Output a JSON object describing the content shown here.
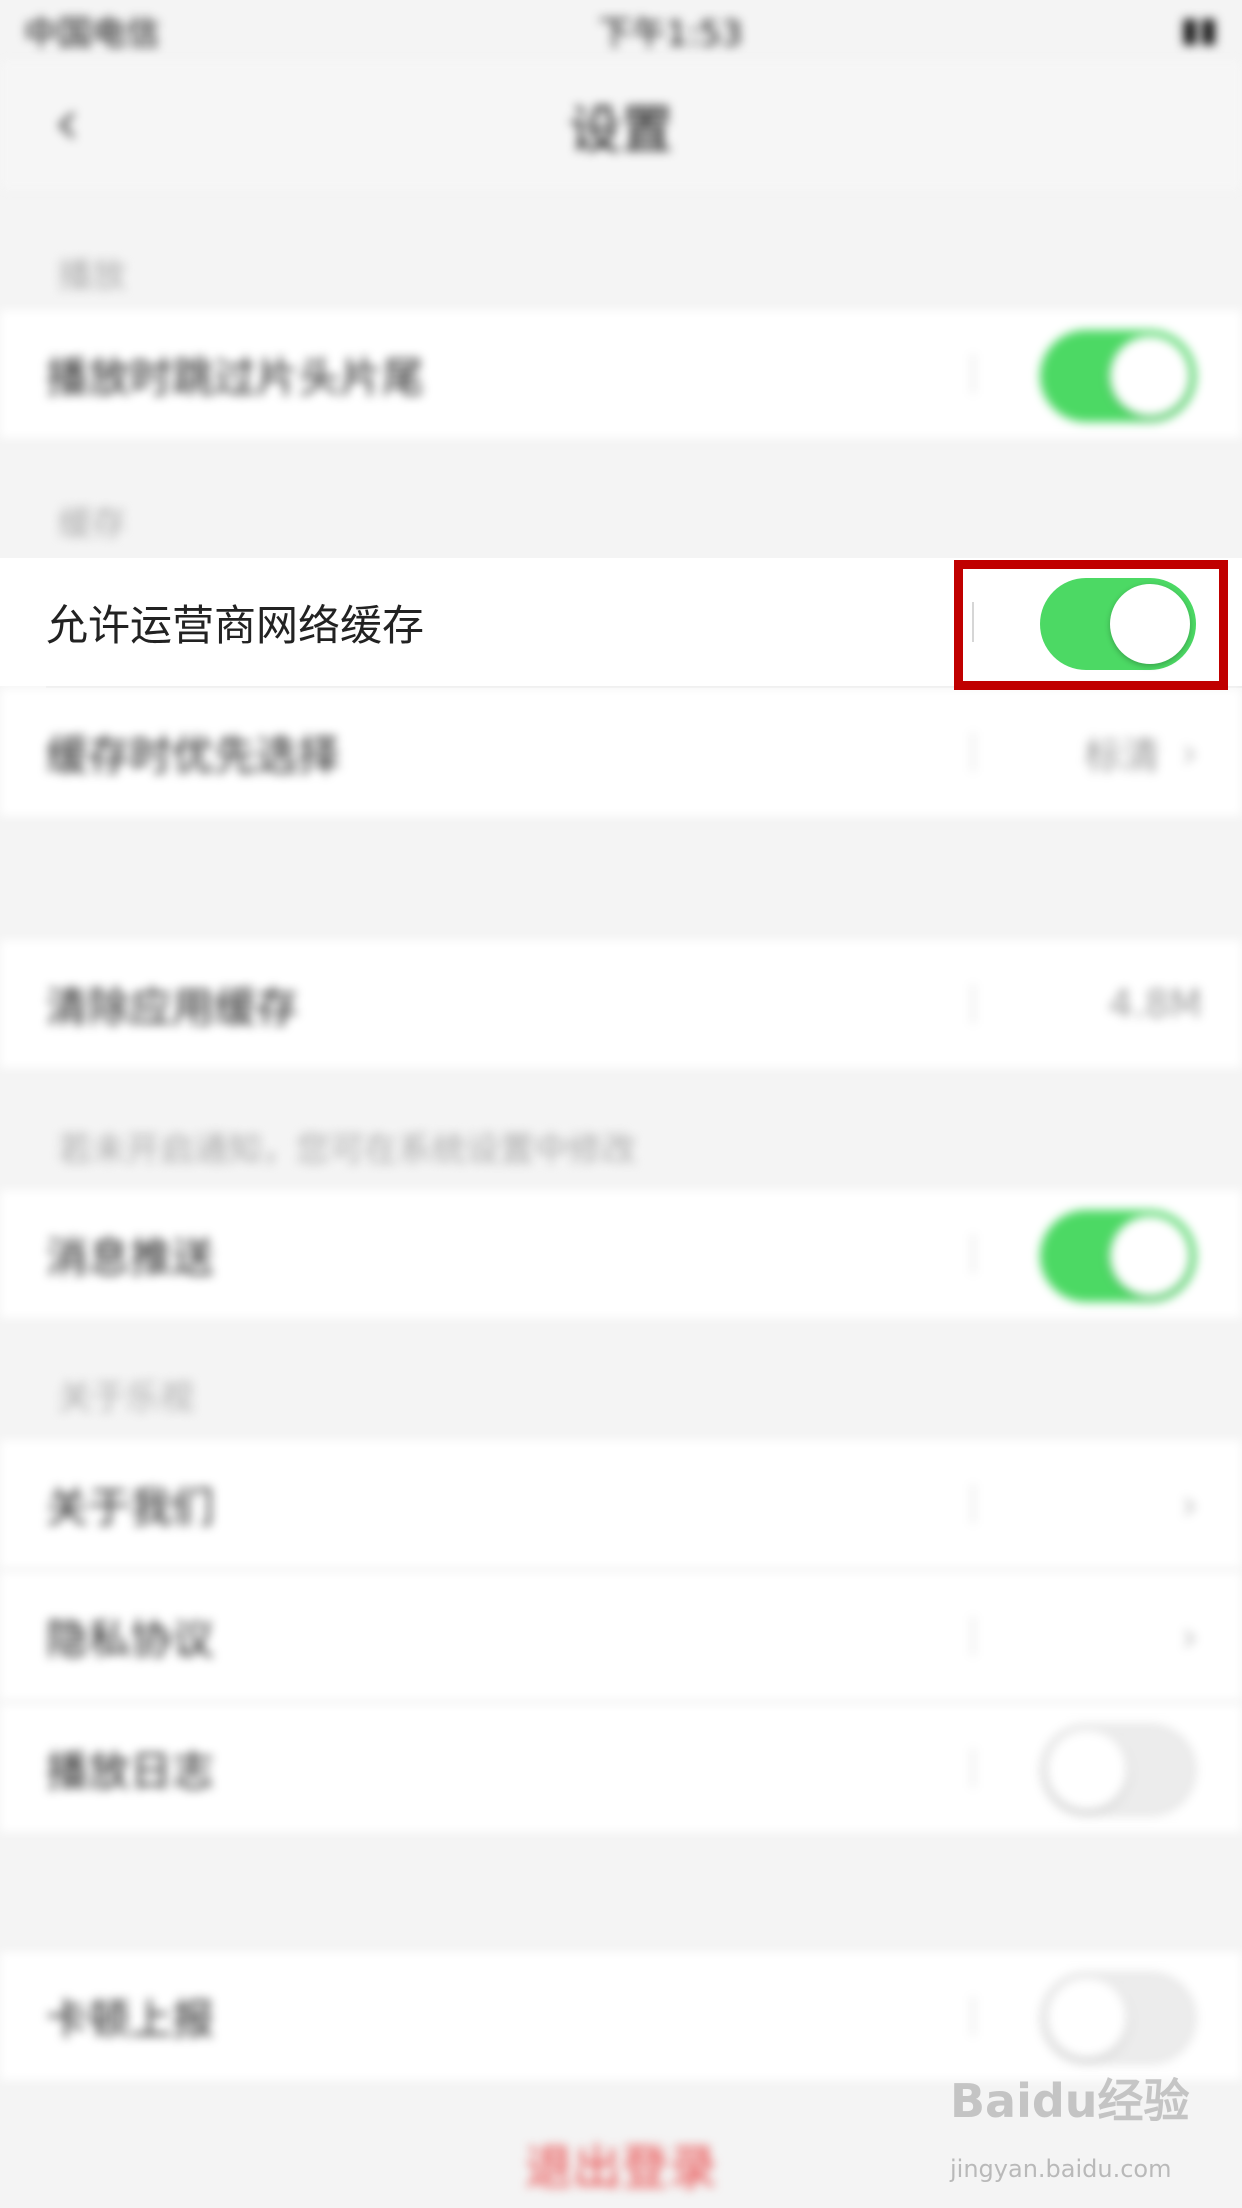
{
  "status_bar": {
    "carrier": "中国电信",
    "time": "下午1:53"
  },
  "nav": {
    "title": "设置",
    "back_icon": "back-chevron-icon"
  },
  "sections": {
    "play": "播放",
    "cache": "缓存",
    "notify": "若未开启通知，您可在系统设置中修改",
    "about": "关于乐视"
  },
  "rows": {
    "skip_intro": "播放时跳过片头片尾",
    "carrier_cache": "允许运营商网络缓存",
    "cache_priority": "缓存时优先选择",
    "cache_priority_value": "标清",
    "clear_cache": "清除应用缓存",
    "clear_cache_value": "4.8M",
    "push": "消息推送",
    "about_us": "关于我们",
    "privacy": "隐私协议",
    "play_log": "播放日志",
    "lag_report": "卡顿上报"
  },
  "logout": "退出登录",
  "watermark": {
    "text": "Baidu经验",
    "sub": "jingyan.baidu.com"
  },
  "colors": {
    "toggle_on": "#4cd964",
    "highlight": "#c00000",
    "logout": "#e84a4a"
  }
}
